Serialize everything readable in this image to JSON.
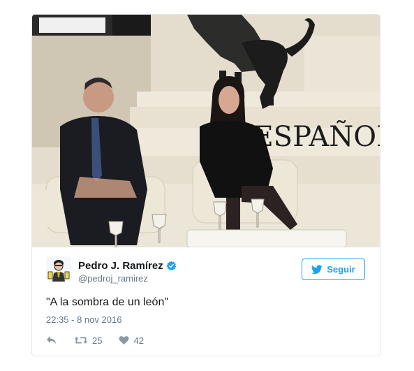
{
  "tweet": {
    "author_name": "Pedro J. Ramírez",
    "handle": "@pedroj_ramirez",
    "follow_label": "Seguir",
    "text": "\"A la sombra de un león\"",
    "timestamp": "22:35 - 8 nov 2016",
    "retweet_count": "25",
    "like_count": "42",
    "photo_sign_text": "EL ESPAÑOL"
  },
  "icons": {
    "avatar": "caricature-avatar",
    "verified": "verified-badge-icon",
    "follow": "twitter-bird-icon",
    "reply": "reply-icon",
    "retweet": "retweet-icon",
    "like": "heart-icon"
  },
  "colors": {
    "accent": "#1da1f2",
    "text_primary": "#14171a",
    "text_secondary": "#657786",
    "border": "#e1e8ed"
  }
}
